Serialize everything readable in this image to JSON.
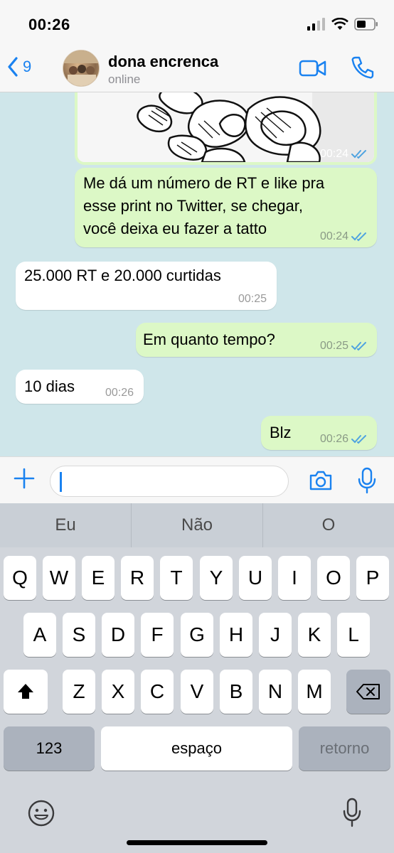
{
  "status_bar": {
    "time": "00:26"
  },
  "header": {
    "back_count": "9",
    "contact_name": "dona encrenca",
    "contact_status": "online"
  },
  "messages": [
    {
      "type": "image",
      "direction": "out",
      "time": "00:24",
      "read": true
    },
    {
      "type": "text",
      "direction": "out",
      "lines": [
        "Me dá um número de RT e like pra",
        "esse print no Twitter, se chegar,",
        "você deixa eu fazer a tatto"
      ],
      "time": "00:24",
      "read": true
    },
    {
      "type": "text",
      "direction": "in",
      "lines": [
        "25.000 RT e 20.000 curtidas"
      ],
      "time": "00:25"
    },
    {
      "type": "text",
      "direction": "out",
      "lines": [
        "Em quanto tempo?"
      ],
      "time": "00:25",
      "read": true
    },
    {
      "type": "text",
      "direction": "in",
      "lines": [
        "10 dias"
      ],
      "time": "00:26"
    },
    {
      "type": "text",
      "direction": "out",
      "lines": [
        "Blz"
      ],
      "time": "00:26",
      "read": true
    }
  ],
  "input": {
    "value": "",
    "placeholder": ""
  },
  "keyboard": {
    "suggestions": [
      "Eu",
      "Não",
      "O"
    ],
    "row1": [
      "Q",
      "W",
      "E",
      "R",
      "T",
      "Y",
      "U",
      "I",
      "O",
      "P"
    ],
    "row2": [
      "A",
      "S",
      "D",
      "F",
      "G",
      "H",
      "J",
      "K",
      "L"
    ],
    "row3": [
      "Z",
      "X",
      "C",
      "V",
      "B",
      "N",
      "M"
    ],
    "numbers_label": "123",
    "space_label": "espaço",
    "return_label": "retorno"
  },
  "colors": {
    "accent": "#1a82f0",
    "chat_bg": "#cfe6ea",
    "outgoing_bubble": "#dcf8c6",
    "incoming_bubble": "#ffffff",
    "read_ticks": "#4fa3e0"
  },
  "icons": [
    "back-chevron-icon",
    "video-call-icon",
    "phone-icon",
    "plus-icon",
    "camera-icon",
    "microphone-icon",
    "shift-icon",
    "backspace-icon",
    "emoji-icon",
    "double-check-icon"
  ]
}
